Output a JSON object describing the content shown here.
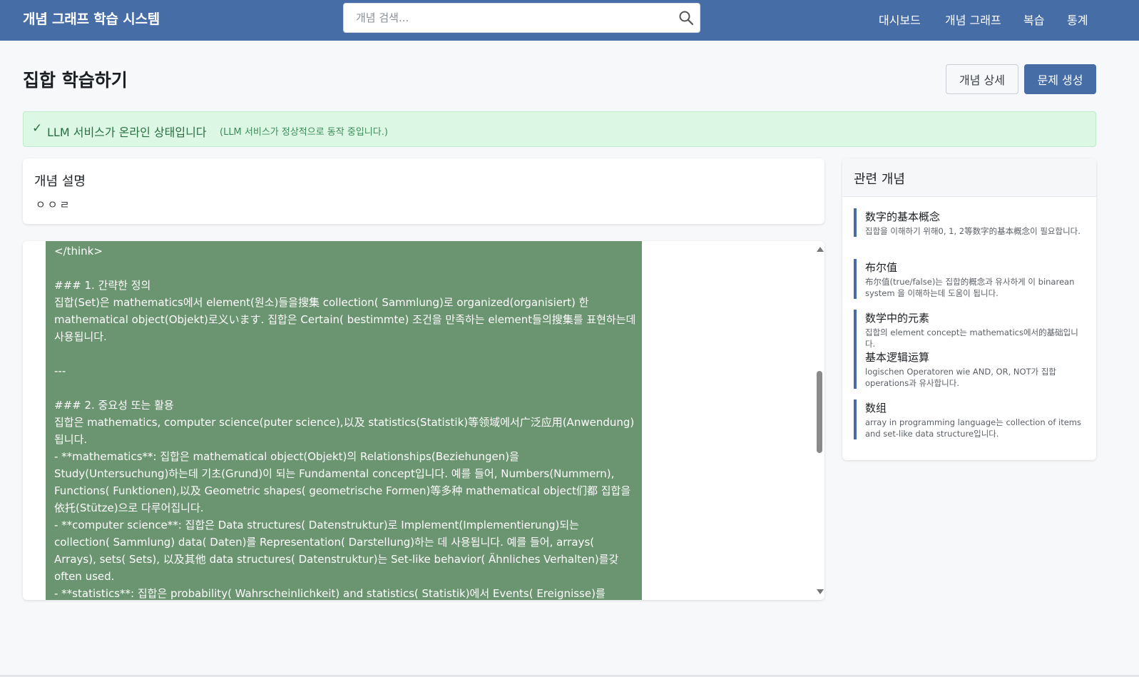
{
  "header": {
    "brand": "개념 그래프 학습 시스템",
    "search_placeholder": "개념 검색...",
    "search_icon": "search-icon",
    "nav": [
      "대시보드",
      "개념 그래프",
      "복습",
      "통계"
    ]
  },
  "page": {
    "title": "집합 학습하기",
    "detail_button": "개념 상세",
    "generate_button": "문제 생성"
  },
  "status": {
    "check": "✓",
    "message": "LLM 서비스가 온라인 상태입니다",
    "detail": "(LLM 서비스가 정상적으로 동작 중입니다.)"
  },
  "description": {
    "title": "개념 설명",
    "text": "ㅇㅇㄹ"
  },
  "generated_content": "</think>\n\n### 1. 간략한 정의\n집합(Set)은 mathematics에서 element(원소)들을搜集 collection( Sammlung)로 organized(organisiert) 한 mathematical object(Objekt)로义います. 집합은 Certain( bestimmte) 조건을 만족하는 element들의搜集를 표현하는데 사용됩니다.\n\n---\n\n### 2. 중요성 또는 활용\n집합은 mathematics, computer science(puter science),以及 statistics(Statistik)等领域에서广泛应用(Anwendung)됩니다.\n- **mathematics**: 집합은 mathematical object(Objekt)의 Relationships(Beziehungen)을 Study(Untersuchung)하는데 기초(Grund)이 되는 Fundamental concept입니다. 예를 들어, Numbers(Nummern), Functions( Funktionen),以及 Geometric shapes( geometrische Formen)等多种 mathematical object们都 집합을依托(Stütze)으로 다루어집니다.\n- **computer science**: 집합은 Data structures( Datenstruktur)로 Implement(Implementierung)되는 collection( Sammlung) data( Daten)를 Representation( Darstellung)하는 데 사용됩니다. 예를 들어, arrays( Arrays), sets( Sets), 以及其他 data structures( Datenstruktur)는 Set-like behavior( Ähnliches Verhalten)를갖 often used.\n- **statistics**: 집합은 probability( Wahrscheinlichkeit) and statistics( Statistik)에서 Events( Ereignisse)를 Representation( Darstellung)하는 데 사용됩니다. 예를 들어, Event A or B occurring( Ereignis A oder B auftritt)는 Set operation( Operationen wie Union( Vereinigung))을 통해 표현합니다.",
  "related": {
    "title": "관련 개념",
    "items": [
      {
        "name": "数字的基本概念",
        "desc": "집합을 이해하기 위해0, 1, 2等数字的基本概念이 필요합니다."
      },
      {
        "name": "布尔值",
        "desc": "布尔值(true/false)는 집합的概念과 유사하게 이 binarean system 을 이해하는데 도움이 됩니다."
      },
      {
        "name": "数学中的元素",
        "desc": "집합의 element concept는 mathematics에서的基础입니다."
      },
      {
        "name": "基本逻辑运算",
        "desc": "logischen Operatoren wie AND, OR, NOT가 집합 operations과 유사합니다."
      },
      {
        "name": "数组",
        "desc": "array in programming language는 collection of items and set-like data structure입니다."
      }
    ]
  },
  "colors": {
    "navbar": "#466da6",
    "primary_button": "#466da6",
    "alert_bg": "#dcf8e5",
    "alert_text": "#2a6e42",
    "generated_bg": "#6b9470"
  }
}
